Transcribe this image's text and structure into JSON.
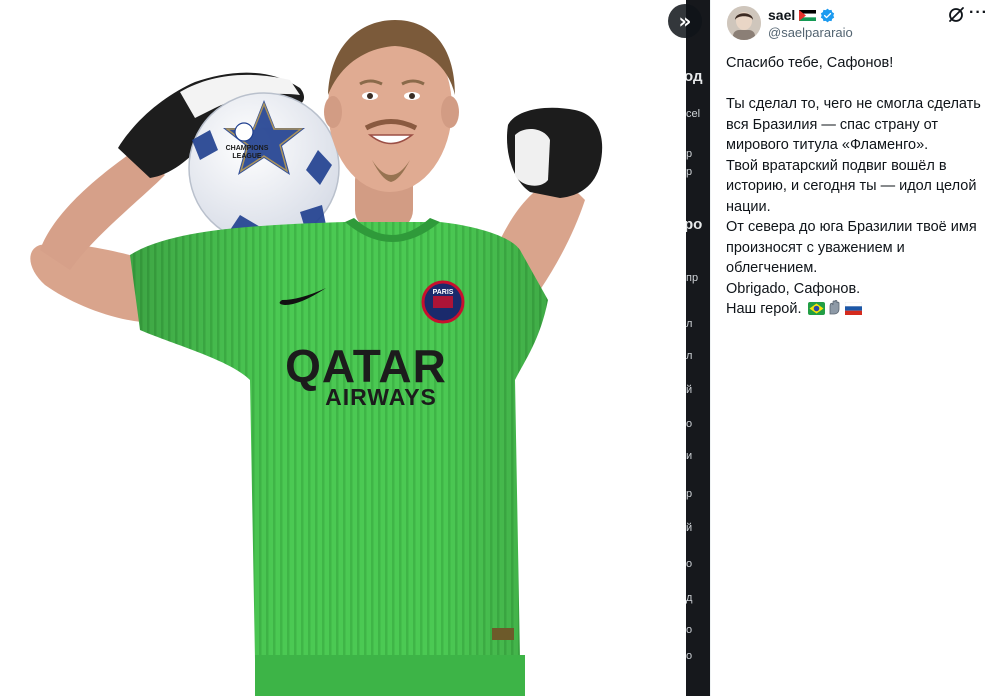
{
  "media": {
    "jersey_sponsor_line1": "QATAR",
    "jersey_sponsor_line2": "AIRWAYS",
    "crest_text": "PARIS",
    "ball_text_line1": "CHAMPIONS",
    "ball_text_line2": "LEAGUE"
  },
  "collapse_button": {
    "icon": "double-chevron-right-icon",
    "glyph": "»"
  },
  "post": {
    "author": {
      "name": "sael",
      "handle": "@saelpararaio"
    },
    "paragraphs": [
      "Спасибо тебе, Сафонов!",
      "Ты сделал то, чего не смогла сделать вся Бразилия — спас страну от мирового титула «Фламенго».",
      "Твой вратарский подвиг вошёл в историю, и сегодня ты — идол целой нации.",
      "От севера до юга Бразилии твоё имя произносят с уважением и облегчением.",
      "Obrigado, Сафонов.",
      "Наш герой."
    ],
    "ending_emojis": [
      "brazil-flag",
      "gloves",
      "russia-flag"
    ]
  },
  "colors": {
    "jersey_green": "#4ccf54",
    "verified_blue": "#1d9bf0",
    "dark_bg": "#16181c"
  }
}
